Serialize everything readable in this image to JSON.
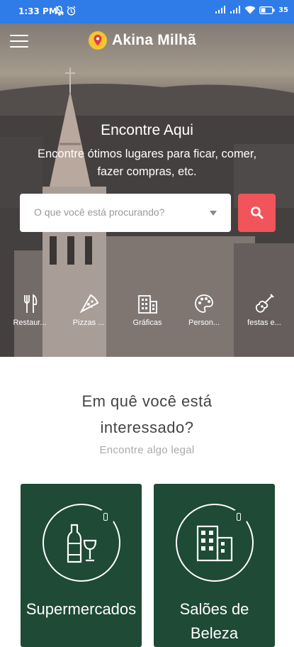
{
  "status_bar": {
    "time": "1:33 PM",
    "battery": "35"
  },
  "header": {
    "app_name": "Akina Milhã"
  },
  "hero": {
    "title": "Encontre Aqui",
    "subtitle": "Encontre ótimos lugares para ficar, comer, fazer compras, etc.",
    "search_placeholder": "O que você está procurando?",
    "categories": [
      {
        "label": "Restaur...",
        "icon": "fork-knife-icon"
      },
      {
        "label": "Pizzas ...",
        "icon": "pizza-icon"
      },
      {
        "label": "Gráficas",
        "icon": "building-icon"
      },
      {
        "label": "Person...",
        "icon": "palette-icon"
      },
      {
        "label": "festas e...",
        "icon": "guitar-icon"
      }
    ]
  },
  "section": {
    "title": "Em quê você está interessado?",
    "subtitle": "Encontre algo legal"
  },
  "cards": [
    {
      "title": "Supermercados",
      "icon": "wine-bottle-glass-icon"
    },
    {
      "title": "Salões de Beleza",
      "icon": "buildings-icon"
    }
  ],
  "colors": {
    "status_bar": "#2f7be8",
    "search_button": "#f2545b",
    "card_bg": "#1e4a36"
  }
}
